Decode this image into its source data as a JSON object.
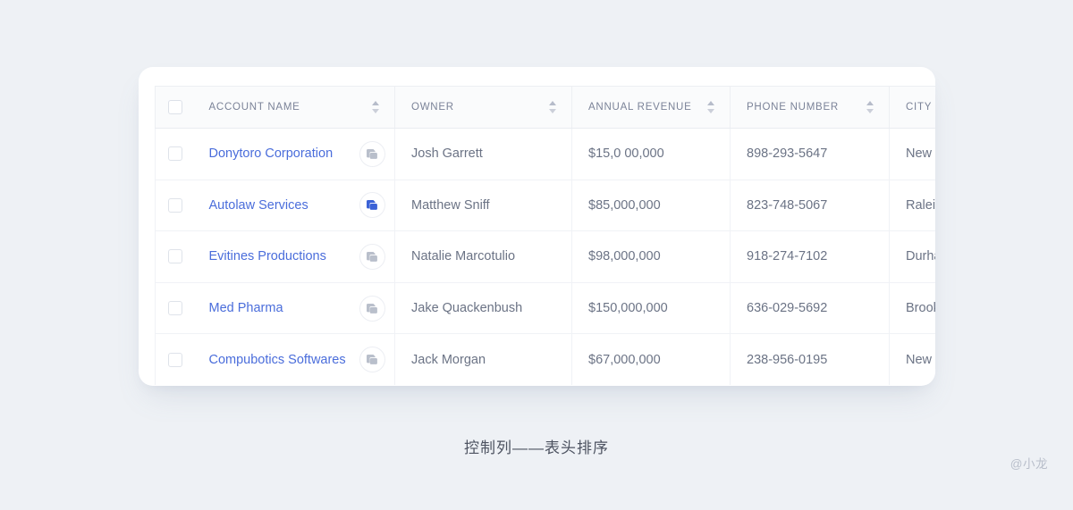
{
  "card": {
    "table": {
      "select_all_checkbox": "unchecked",
      "columns": [
        {
          "label": "ACCOUNT NAME",
          "sortable": true
        },
        {
          "label": "OWNER",
          "sortable": true
        },
        {
          "label": "ANNUAL REVENUE",
          "sortable": true
        },
        {
          "label": "PHONE NUMBER",
          "sortable": true
        },
        {
          "label": "CITY",
          "sortable": false
        }
      ],
      "rows": [
        {
          "checkbox": "unchecked",
          "account_name": "Donytoro Corporation",
          "row_action_icon": "copy-icon",
          "row_action_active": false,
          "owner": "Josh Garrett",
          "annual_revenue": "$15,0 00,000",
          "phone_number": "898-293-5647",
          "city": "New York"
        },
        {
          "checkbox": "unchecked",
          "account_name": "Autolaw Services",
          "row_action_icon": "copy-icon",
          "row_action_active": true,
          "owner": "Matthew Sniff",
          "annual_revenue": "$85,000,000",
          "phone_number": "823-748-5067",
          "city": "Raleigh"
        },
        {
          "checkbox": "unchecked",
          "account_name": "Evitines Productions",
          "row_action_icon": "copy-icon",
          "row_action_active": false,
          "owner": "Natalie Marcotulio",
          "annual_revenue": "$98,000,000",
          "phone_number": "918-274-7102",
          "city": "Durham"
        },
        {
          "checkbox": "unchecked",
          "account_name": "Med Pharma",
          "row_action_icon": "copy-icon",
          "row_action_active": false,
          "owner": "Jake Quackenbush",
          "annual_revenue": "$150,000,000",
          "phone_number": "636-029-5692",
          "city": "Brooklyn"
        },
        {
          "checkbox": "unchecked",
          "account_name": "Compubotics Softwares",
          "row_action_icon": "copy-icon",
          "row_action_active": false,
          "owner": "Jack Morgan",
          "annual_revenue": "$67,000,000",
          "phone_number": "238-956-0195",
          "city": "New York"
        }
      ]
    }
  },
  "caption": "控制列——表头排序",
  "watermark": "@小龙",
  "colors": {
    "page_background": "#eef1f5",
    "card_background": "#ffffff",
    "header_background": "#fafbfc",
    "link_blue": "#4a6ddb",
    "accent_blue": "#3b62d6",
    "text_muted": "#6b7385",
    "header_text": "#7b8398",
    "divider": "#f0f2f6"
  }
}
